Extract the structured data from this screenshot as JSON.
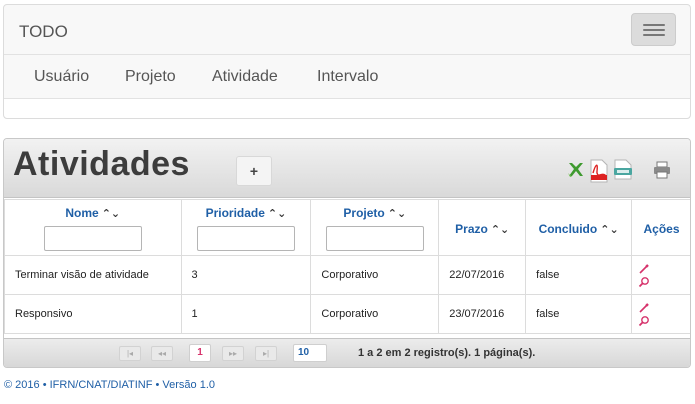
{
  "navbar": {
    "brand": "TODO",
    "links": [
      "Usuário",
      "Projeto",
      "Atividade",
      "Intervalo"
    ]
  },
  "panel": {
    "title": "Atividades",
    "add_label": "+",
    "export_icons": [
      "excel-icon",
      "pdf-icon",
      "csv-icon",
      "print-icon"
    ]
  },
  "table": {
    "columns": [
      "Nome",
      "Prioridade",
      "Projeto",
      "Prazo",
      "Concluido",
      "Ações"
    ],
    "sort_glyph": "⌃⌄",
    "rows": [
      {
        "nome": "Terminar visão de atividade",
        "prioridade": "3",
        "projeto": "Corporativo",
        "prazo": "22/07/2016",
        "concluido": "false"
      },
      {
        "nome": "Responsivo",
        "prioridade": "1",
        "projeto": "Corporativo",
        "prazo": "23/07/2016",
        "concluido": "false"
      }
    ]
  },
  "paginator": {
    "first": "|◂",
    "prev": "◂◂",
    "current_page": "1",
    "next": "▸▸",
    "last": "▸|",
    "rows_per_page": "10",
    "report": "1 a 2 em 2 registro(s). 1 página(s)."
  },
  "footer": {
    "text": "©  2016  •  IFRN/CNAT/DIATINF  •  Versão 1.0"
  },
  "colors": {
    "link_blue": "#1f5fa6",
    "active_page": "#d6326b"
  }
}
